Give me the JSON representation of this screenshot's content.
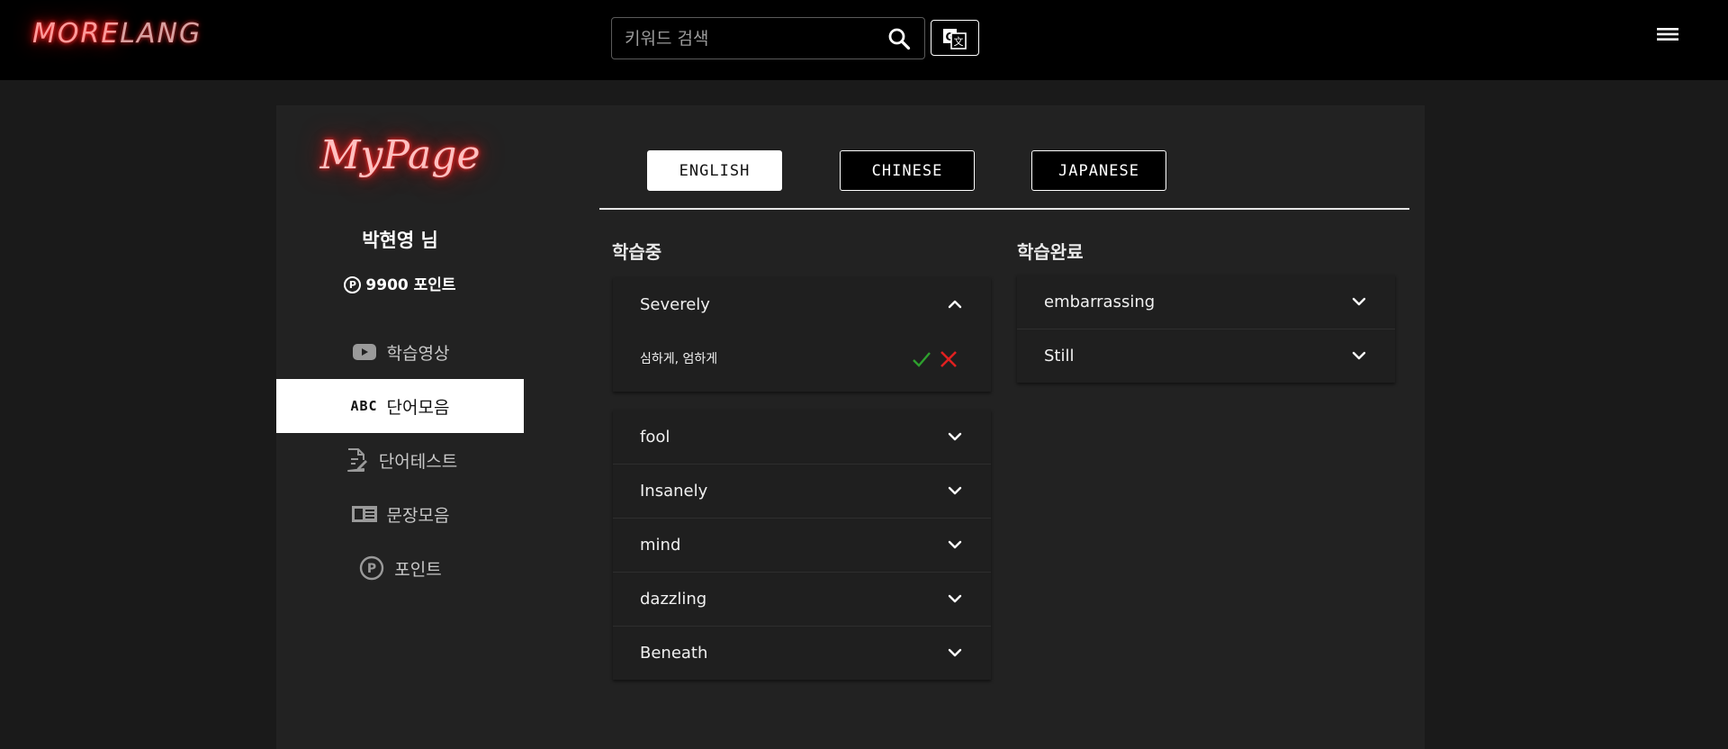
{
  "header": {
    "logo_main": "MORE",
    "logo_dim": "LANG",
    "search_placeholder": "키워드 검색"
  },
  "sidebar": {
    "title": "MyPage",
    "username": "박현영 님",
    "points_symbol": "P",
    "points": "9900 포인트",
    "items": [
      {
        "label": "학습영상",
        "icon": "youtube-icon"
      },
      {
        "label": "단어모음",
        "icon": "abc-icon",
        "icon_text": "ABC",
        "active": true
      },
      {
        "label": "단어테스트",
        "icon": "document-edit-icon"
      },
      {
        "label": "문장모음",
        "icon": "book-icon"
      },
      {
        "label": "포인트",
        "icon": "point-icon",
        "icon_text": "P"
      }
    ]
  },
  "tabs": [
    {
      "label": "ENGLISH",
      "active": true
    },
    {
      "label": "CHINESE",
      "active": false
    },
    {
      "label": "JAPANESE",
      "active": false
    }
  ],
  "learning": {
    "title": "학습중",
    "expanded": {
      "word": "Severely",
      "meaning": "심하게, 엄하게"
    },
    "words": [
      "fool",
      "Insanely",
      "mind",
      "dazzling",
      "Beneath"
    ]
  },
  "completed": {
    "title": "학습완료",
    "words": [
      "embarrassing",
      "Still"
    ]
  },
  "colors": {
    "accent_neon": "#ff2a2a",
    "check": "#2ea02e",
    "cross": "#e02020"
  }
}
